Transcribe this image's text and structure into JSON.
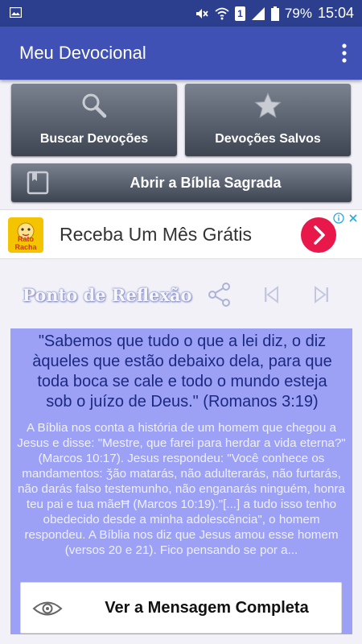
{
  "status_bar": {
    "battery_percent": "79%",
    "time": "15:04",
    "sim_label": "1",
    "icons": [
      "image-icon",
      "mute-icon",
      "wifi-icon",
      "sim-icon",
      "signal-icon",
      "battery-icon"
    ]
  },
  "app_bar": {
    "title": "Meu Devocional",
    "overflow_icon": "more-vert-icon"
  },
  "buttons": {
    "buscar": {
      "label": "Buscar Devoções",
      "icon": "search-icon"
    },
    "salvos": {
      "label": "Devoções Salvos",
      "icon": "star-icon"
    },
    "biblia": {
      "label": "Abrir a Bíblia Sagrada",
      "icon": "book-icon"
    }
  },
  "ad": {
    "headline": "Receba Um Mês Grátis",
    "logo_text": "Rato Racha",
    "accent": "#e9184a"
  },
  "reflection": {
    "title": "Ponto de Reflexão",
    "icons": [
      "share-icon",
      "skip-previous-icon",
      "skip-next-icon"
    ]
  },
  "devotional": {
    "verse": "\"Sabemos que tudo o que a lei diz, o diz àqueles que estão debaixo dela, para que toda boca se cale e todo o mundo esteja sob o juízo de Deus.\" (Romanos 3:19)",
    "body": "A Bíblia nos conta a história de um homem que chegou a Jesus e disse: \"Mestre, que farei para herdar a vida eterna?\" (Marcos 10:17). Jesus respondeu: \"Você conhece os mandamentos: ǯão matarás, não adulterarás, não furtarás, não darás falso testemunho, não enganarás ninguém, honra teu pai e tua mãeĦ (Marcos 10:19).\"[...] a tudo isso tenho obedecido desde a minha adolescência\", o homem respondeu. A Bíblia nos diz que Jesus amou esse homem (versos 20 e 21). Fico pensando se por a...",
    "card_color": "#9da1f5",
    "verse_color": "#1a2a80"
  },
  "ver_button": {
    "label": "Ver a Mensagem Completa",
    "icon": "eye-icon"
  }
}
